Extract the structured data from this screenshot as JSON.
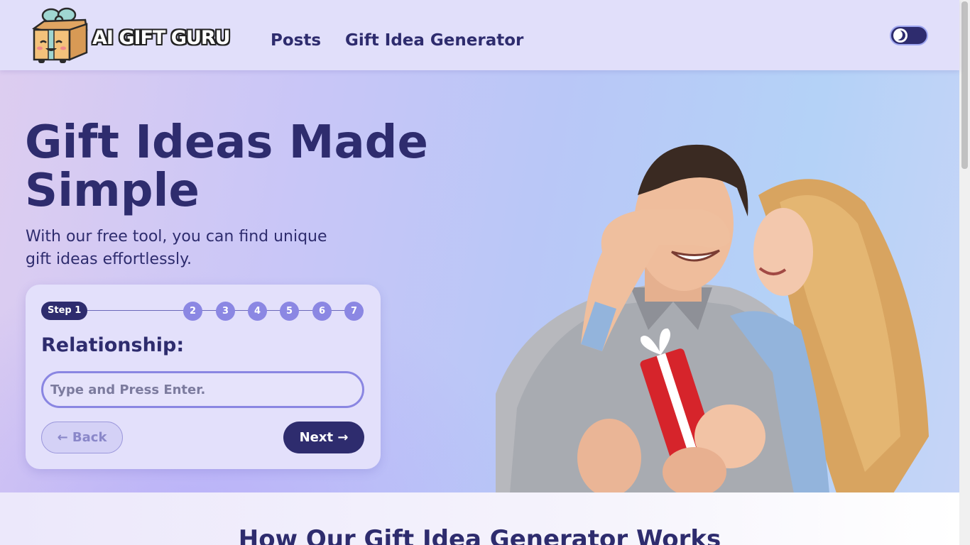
{
  "header": {
    "logo_text": "AI GIFT GURU",
    "nav": [
      {
        "label": "Posts"
      },
      {
        "label": "Gift Idea Generator"
      }
    ],
    "theme_toggle_icon": "moon-icon"
  },
  "hero": {
    "title": "Gift Ideas Made Simple",
    "subtitle": "With our free tool, you can find unique gift ideas effortlessly."
  },
  "form": {
    "active_step": "Step 1",
    "steps": [
      "2",
      "3",
      "4",
      "5",
      "6",
      "7"
    ],
    "question_label": "Relationship:",
    "input_placeholder": "Type and Press Enter.",
    "input_value": "",
    "back_label": "← Back",
    "next_label": "Next →"
  },
  "section": {
    "title": "How Our Gift Idea Generator Works"
  },
  "colors": {
    "brand_dark": "#2e2c6e",
    "step_inactive": "#8b87e3",
    "card_bg": "#e3e0fb",
    "header_bg": "#e1dffa"
  }
}
